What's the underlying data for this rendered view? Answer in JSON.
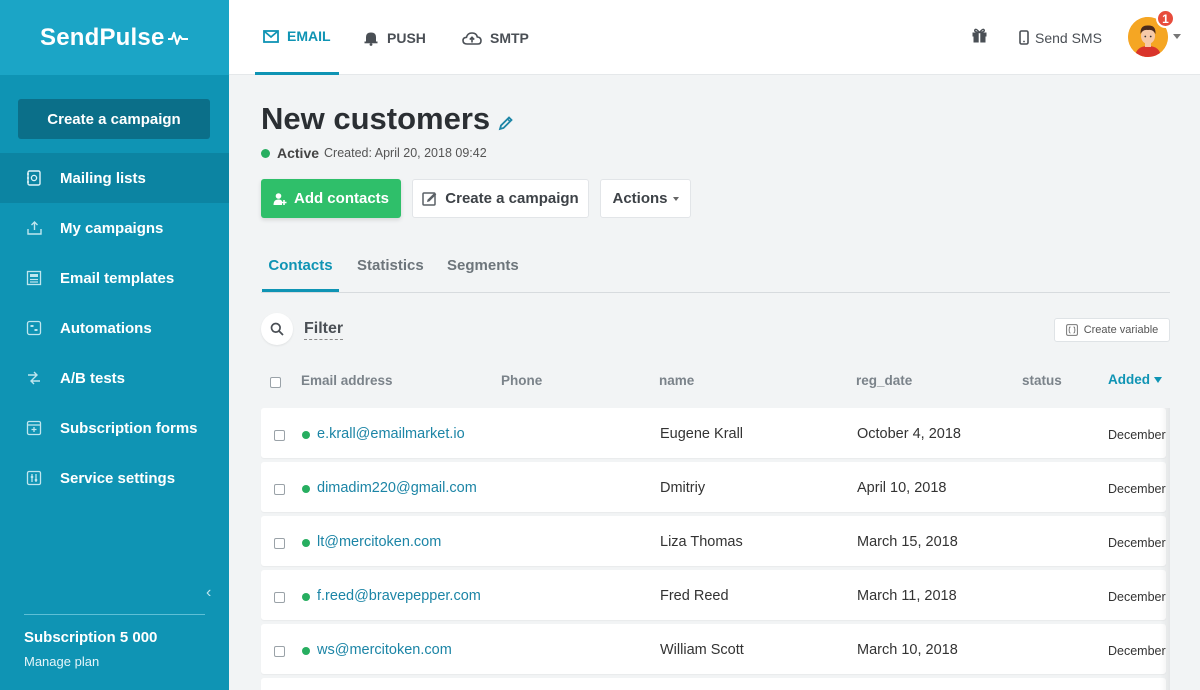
{
  "brand": {
    "name": "SendPulse"
  },
  "sidebar": {
    "create_campaign": "Create a campaign",
    "items": [
      {
        "label": "Mailing lists",
        "icon": "mailing-lists-icon",
        "active": true
      },
      {
        "label": "My campaigns",
        "icon": "campaigns-icon",
        "active": false
      },
      {
        "label": "Email templates",
        "icon": "templates-icon",
        "active": false
      },
      {
        "label": "Automations",
        "icon": "automations-icon",
        "active": false
      },
      {
        "label": "A/B tests",
        "icon": "ab-tests-icon",
        "active": false
      },
      {
        "label": "Subscription forms",
        "icon": "forms-icon",
        "active": false
      },
      {
        "label": "Service settings",
        "icon": "settings-icon",
        "active": false
      }
    ],
    "subscription": "Subscription 5 000",
    "manage_plan": "Manage plan"
  },
  "topbar": {
    "tabs": [
      {
        "label": "EMAIL",
        "icon": "envelope-icon",
        "active": true
      },
      {
        "label": "PUSH",
        "icon": "bell-icon",
        "active": false
      },
      {
        "label": "SMTP",
        "icon": "cloud-upload-icon",
        "active": false
      }
    ],
    "send_sms": "Send SMS",
    "notifications": "1"
  },
  "page": {
    "title": "New customers",
    "status": "Active",
    "created": "Created: April 20, 2018 09:42",
    "buttons": {
      "add_contacts": "Add contacts",
      "create_campaign": "Create a campaign",
      "actions": "Actions"
    },
    "tabs": [
      "Contacts",
      "Statistics",
      "Segments"
    ],
    "active_tab": "Contacts",
    "filter": "Filter",
    "create_variable": "Create variable"
  },
  "table": {
    "columns": {
      "email": "Email address",
      "phone": "Phone",
      "name": "name",
      "reg_date": "reg_date",
      "status": "status",
      "added": "Added"
    },
    "rows": [
      {
        "email": "e.krall@emailmarket.io",
        "phone": "",
        "name": "Eugene Krall",
        "reg_date": "October 4, 2018",
        "added": "December"
      },
      {
        "email": "dimadim220@gmail.com",
        "phone": "",
        "name": "Dmitriy",
        "reg_date": "April 10, 2018",
        "added": "December"
      },
      {
        "email": "lt@mercitoken.com",
        "phone": "",
        "name": "Liza Thomas",
        "reg_date": "March 15, 2018",
        "added": "December"
      },
      {
        "email": "f.reed@bravepepper.com",
        "phone": "",
        "name": "Fred Reed",
        "reg_date": "March 11, 2018",
        "added": "December"
      },
      {
        "email": "ws@mercitoken.com",
        "phone": "",
        "name": "William Scott",
        "reg_date": "March 10, 2018",
        "added": "December"
      }
    ]
  },
  "colors": {
    "sidebar": "#0f94b4",
    "accent": "#0f94b4",
    "green": "#2fbf6a",
    "active_dot": "#27ae60",
    "badge": "#e74c3c"
  }
}
